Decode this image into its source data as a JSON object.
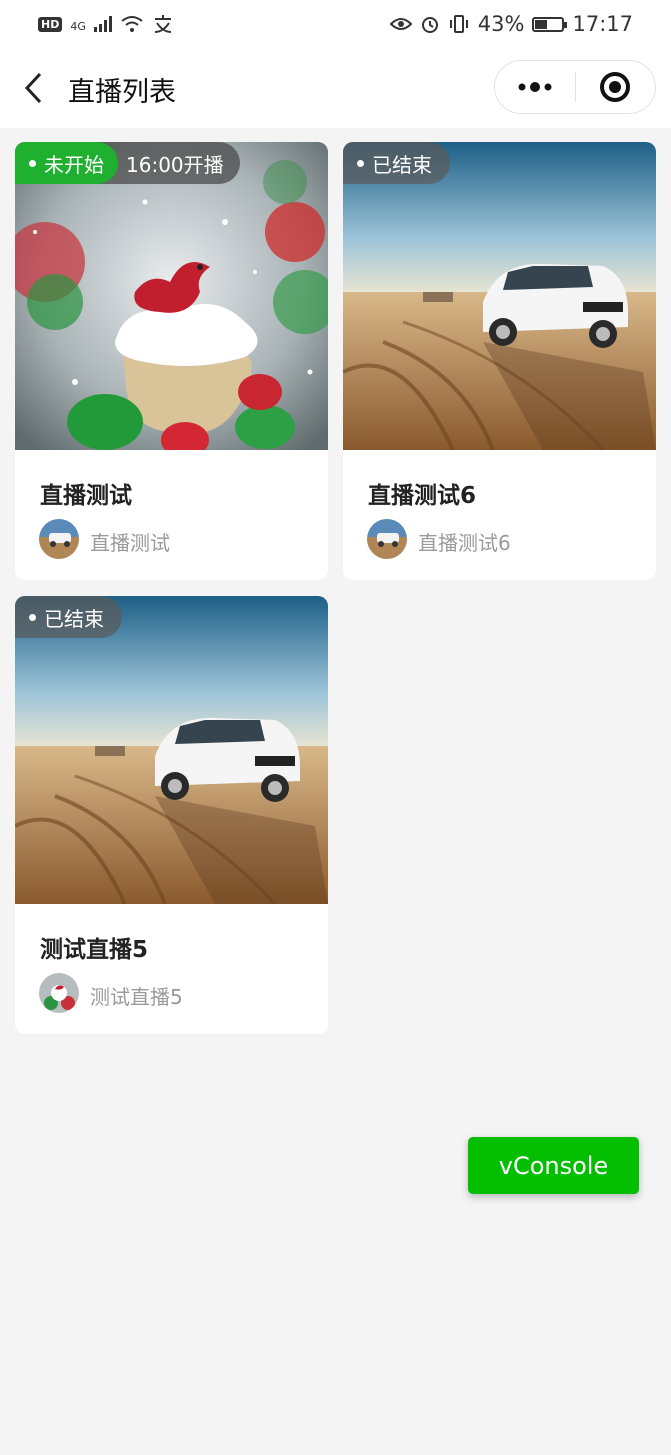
{
  "status_bar": {
    "hd": "HD",
    "network": "4G",
    "battery_percent": "43%",
    "time": "17:17",
    "icons": [
      "hd-icon",
      "signal-icon",
      "wifi-icon",
      "pay-icon",
      "eye-icon",
      "alarm-icon",
      "vibrate-icon",
      "battery-icon"
    ]
  },
  "nav": {
    "title": "直播列表",
    "back_icon": "chevron-left-icon",
    "more_icon": "more-dots-icon",
    "close_icon": "target-close-icon"
  },
  "cards": [
    {
      "status": "未开始",
      "start_time": "16:00开播",
      "title": "直播测试",
      "anchor_name": "直播测试",
      "cover": "cookie-dessert-image",
      "avatar": "car-avatar"
    },
    {
      "status": "已结束",
      "title": "直播测试6",
      "anchor_name": "直播测试6",
      "cover": "white-suv-desert-image",
      "avatar": "car-avatar"
    },
    {
      "status": "已结束",
      "title": "测试直播5",
      "anchor_name": "测试直播5",
      "cover": "white-suv-desert-image",
      "avatar": "cookie-avatar"
    }
  ],
  "vconsole": {
    "label": "vConsole",
    "color": "#04be02"
  },
  "colors": {
    "live_upcoming": "#20b030",
    "background": "#f4f4f4"
  }
}
